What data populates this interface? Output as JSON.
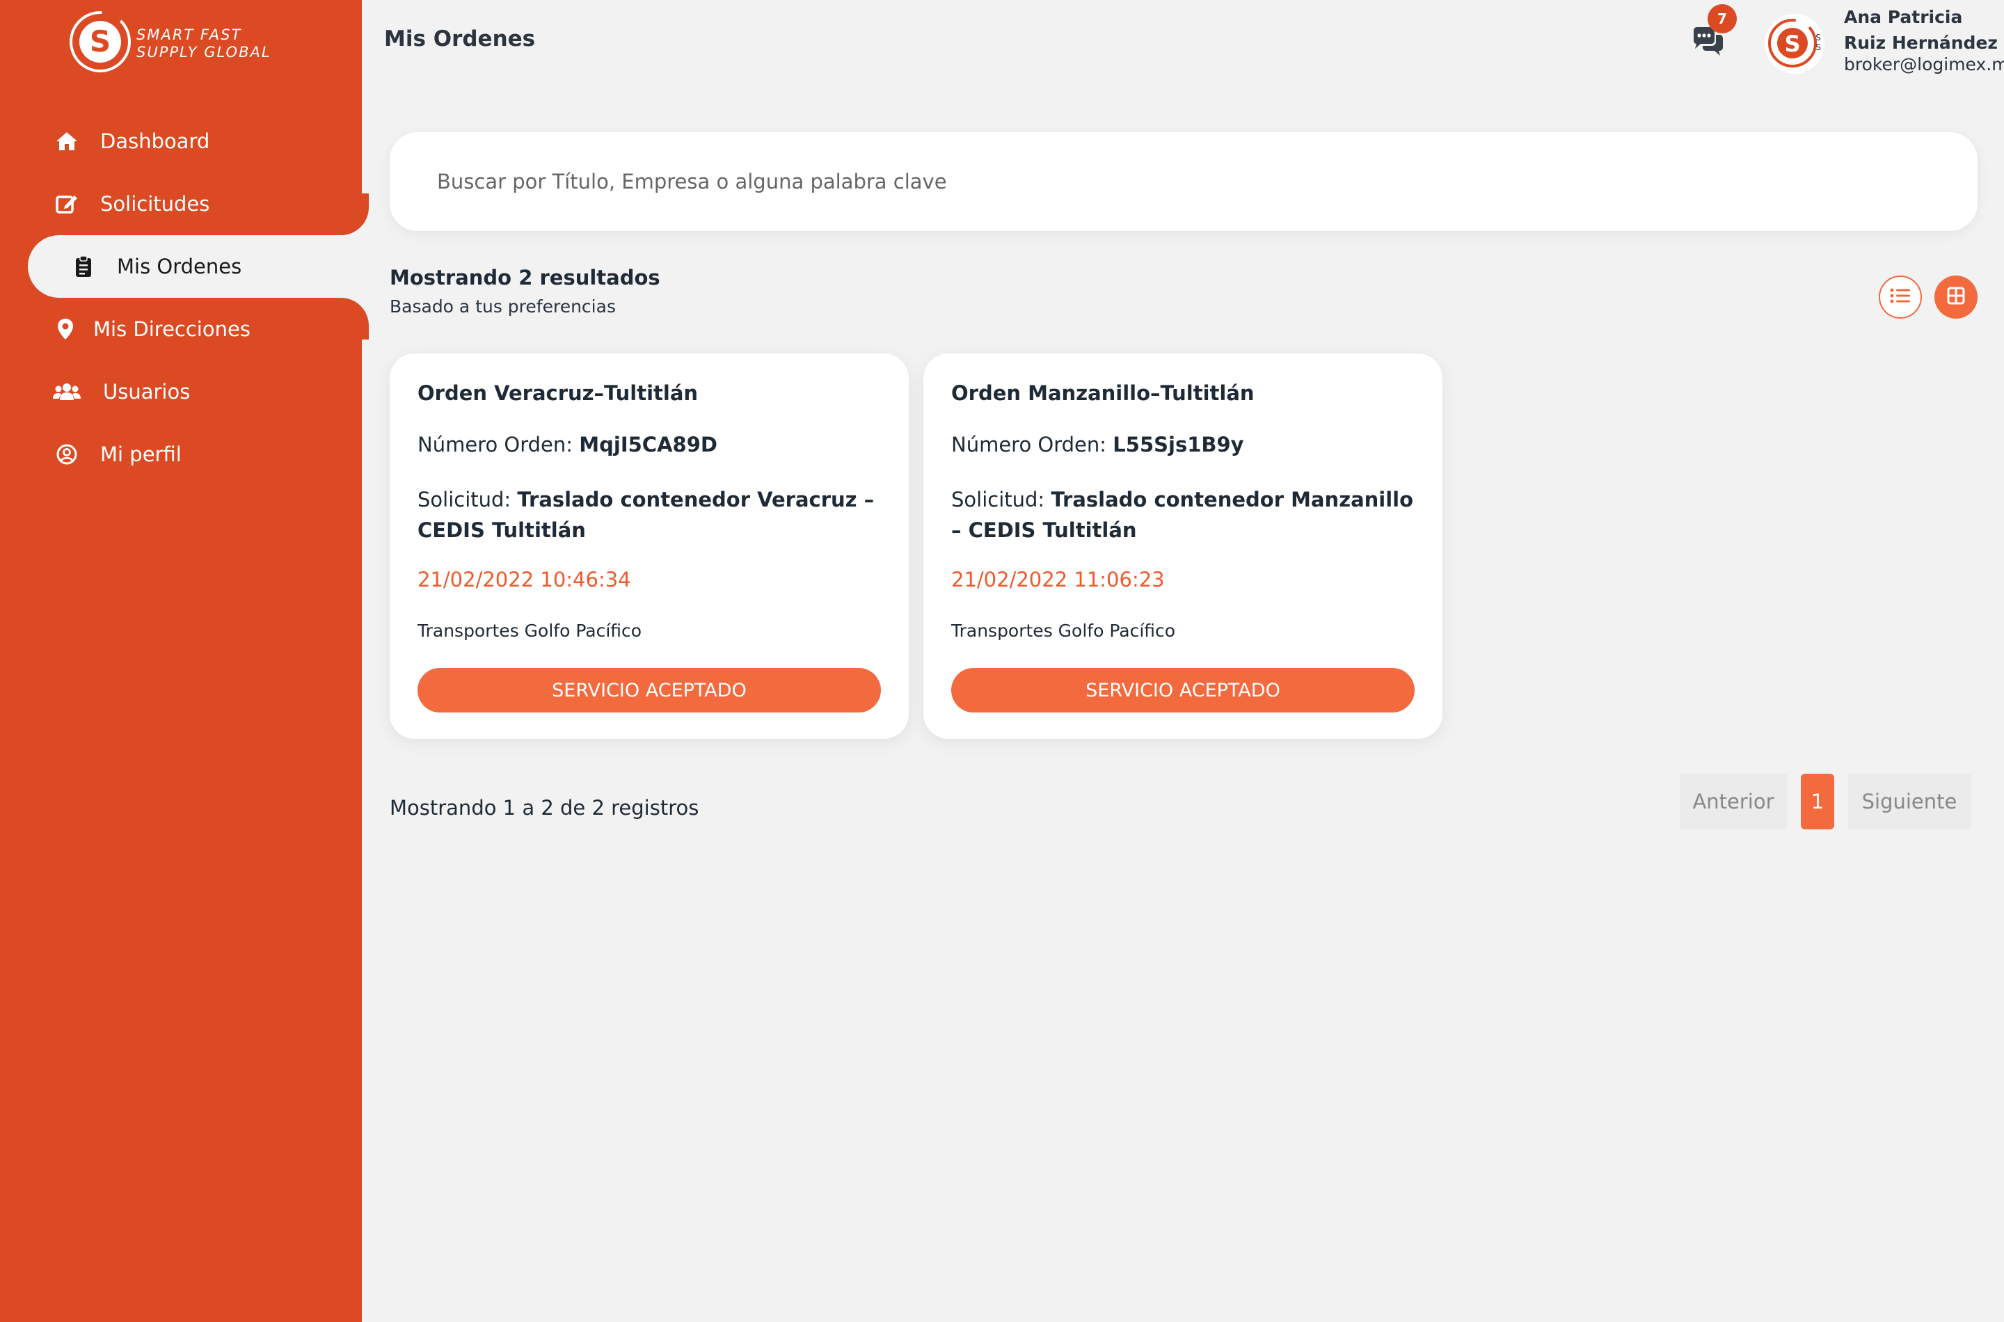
{
  "brand": {
    "logo_line1": "SMART FAST",
    "logo_line2": "SUPPLY GLOBAL",
    "primary_color": "#db4a22",
    "accent_color": "#f26a3d"
  },
  "sidebar": {
    "items": [
      {
        "label": "Dashboard",
        "icon": "home-icon"
      },
      {
        "label": "Solicitudes",
        "icon": "edit-icon"
      },
      {
        "label": "Mis Ordenes",
        "icon": "clipboard-icon",
        "active": true
      },
      {
        "label": "Mis Direcciones",
        "icon": "map-pin-icon"
      },
      {
        "label": "Usuarios",
        "icon": "users-icon"
      },
      {
        "label": "Mi perfil",
        "icon": "user-circle-icon"
      }
    ]
  },
  "header": {
    "title": "Mis Ordenes",
    "notifications_count": "7",
    "user_name": "Ana Patricia Ruiz Hernández",
    "user_email": "broker@logimex.mx"
  },
  "search": {
    "placeholder": "Buscar por Título, Empresa o alguna palabra clave",
    "value": ""
  },
  "results": {
    "title": "Mostrando 2 resultados",
    "subtitle": "Basado a tus preferencias"
  },
  "orders": [
    {
      "title": "Orden Veracruz–Tultitlán",
      "number_label": "Número Orden: ",
      "number": "MqjI5CA89D",
      "request_label": "Solicitud: ",
      "request": "Traslado contenedor Veracruz – CEDIS Tultitlán",
      "date": "21/02/2022 10:46:34",
      "company": "Transportes Golfo Pacífico",
      "status": "SERVICIO ACEPTADO"
    },
    {
      "title": "Orden Manzanillo–Tultitlán",
      "number_label": "Número Orden: ",
      "number": "L55Sjs1B9y",
      "request_label": "Solicitud: ",
      "request": "Traslado contenedor Manzanillo – CEDIS Tultitlán",
      "date": "21/02/2022 11:06:23",
      "company": "Transportes Golfo Pacífico",
      "status": "SERVICIO ACEPTADO"
    }
  ],
  "pagination": {
    "summary": "Mostrando 1 a 2 de 2 registros",
    "prev": "Anterior",
    "current": "1",
    "next": "Siguiente"
  }
}
